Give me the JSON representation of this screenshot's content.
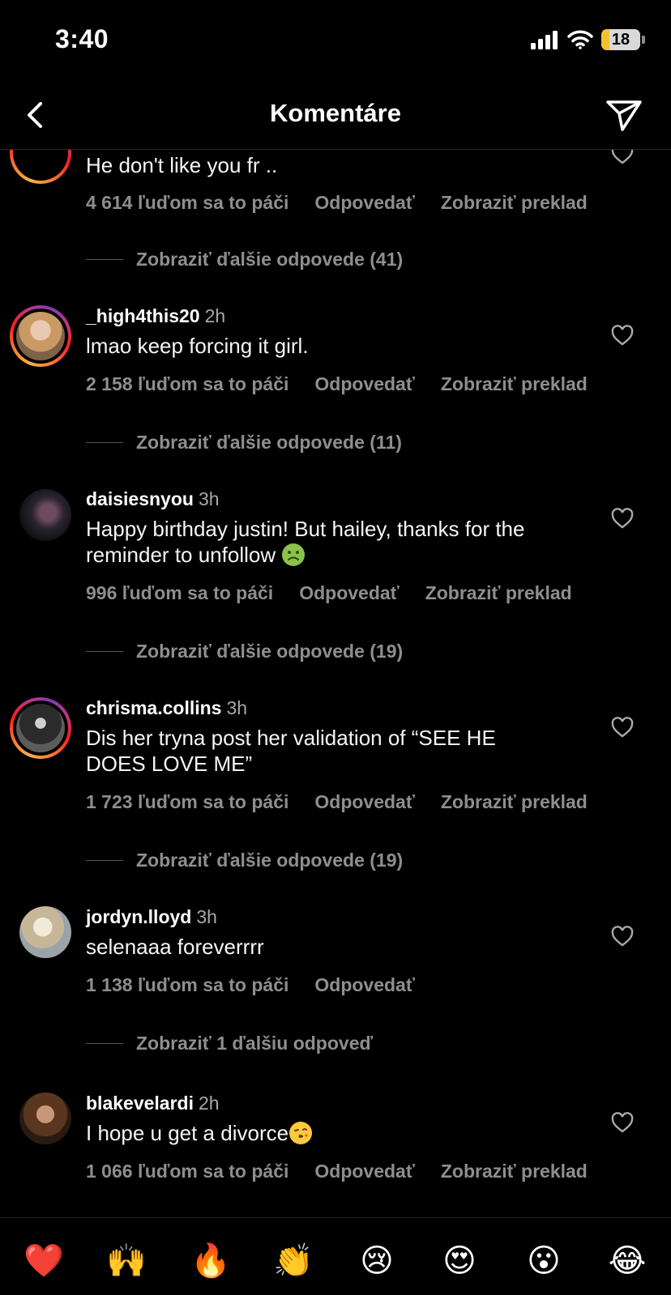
{
  "status_bar": {
    "time": "3:40",
    "battery": "18",
    "battery_color": "#f3c233"
  },
  "header": {
    "title": "Komentáre",
    "back_icon": "chevron-left-icon",
    "share_icon": "paper-plane-icon"
  },
  "comments": [
    {
      "text": "He don't like you fr ..",
      "likes": "4 614 ľuďom sa to páči",
      "reply": "Odpovedať",
      "translate": "Zobraziť preklad",
      "more_replies": "Zobraziť ďalšie odpovede (41)"
    },
    {
      "username": "_high4this20",
      "time": "2h",
      "text": "lmao keep forcing it girl.",
      "likes": "2 158 ľuďom sa to páči",
      "reply": "Odpovedať",
      "translate": "Zobraziť preklad",
      "more_replies": "Zobraziť ďalšie odpovede (11)"
    },
    {
      "username": "daisiesnyou",
      "time": "3h",
      "text": "Happy birthday justin! But hailey, thanks for the reminder to unfollow",
      "text_emoji": "nauseated-face-emoji",
      "likes": "996 ľuďom sa to páči",
      "reply": "Odpovedať",
      "translate": "Zobraziť preklad",
      "more_replies": "Zobraziť ďalšie odpovede (19)"
    },
    {
      "username": "chrisma.collins",
      "time": "3h",
      "text": "Dis her tryna post her validation of “SEE HE DOES LOVE ME”",
      "likes": "1 723 ľuďom sa to páči",
      "reply": "Odpovedať",
      "translate": "Zobraziť preklad",
      "more_replies": "Zobraziť ďalšie odpovede (19)"
    },
    {
      "username": "jordyn.lloyd",
      "time": "3h",
      "text": "selenaaa foreverrrr",
      "likes": "1 138 ľuďom sa to páči",
      "reply": "Odpovedať",
      "more_replies": "Zobraziť 1 ďalšiu odpoveď"
    },
    {
      "username": "blakevelardi",
      "time": "2h",
      "text": "I hope u get a divorce",
      "text_emoji": "face-blowing-kiss-emoji",
      "likes": "1 066 ľuďom sa to páči",
      "reply": "Odpovedať",
      "translate": "Zobraziť preklad"
    }
  ],
  "emoji_bar": [
    {
      "name": "red-heart-emoji",
      "glyph": "❤️"
    },
    {
      "name": "raising-hands-emoji",
      "glyph": "🙌"
    },
    {
      "name": "fire-emoji",
      "glyph": "🔥"
    },
    {
      "name": "clapping-hands-emoji",
      "glyph": "👏"
    },
    {
      "name": "crying-face-emoji",
      "glyph": "😢"
    },
    {
      "name": "heart-eyes-emoji",
      "glyph": "😍"
    },
    {
      "name": "surprised-face-emoji",
      "glyph": "😮"
    },
    {
      "name": "tears-of-joy-emoji",
      "glyph": "😂"
    }
  ]
}
